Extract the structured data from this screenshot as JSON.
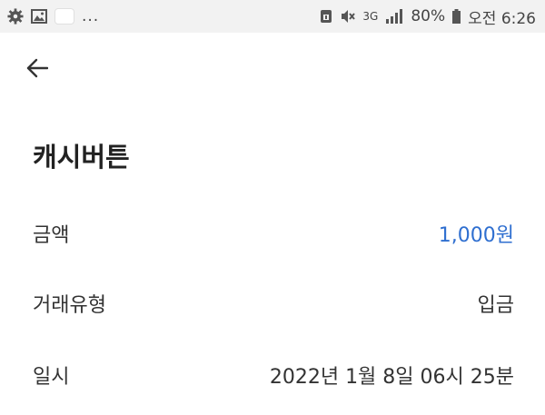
{
  "status_bar": {
    "overflow": "...",
    "network": "3G",
    "battery": "80%",
    "time": "오전 6:26"
  },
  "detail": {
    "title": "캐시버튼",
    "rows": [
      {
        "label": "금액",
        "value": "1,000원"
      },
      {
        "label": "거래유형",
        "value": "입금"
      },
      {
        "label": "일시",
        "value": "2022년 1월 8일 06시 25분"
      }
    ]
  },
  "colors": {
    "amount": "#2f6fd0",
    "status_bar_bg": "#f2f2f2",
    "text": "#333333"
  }
}
